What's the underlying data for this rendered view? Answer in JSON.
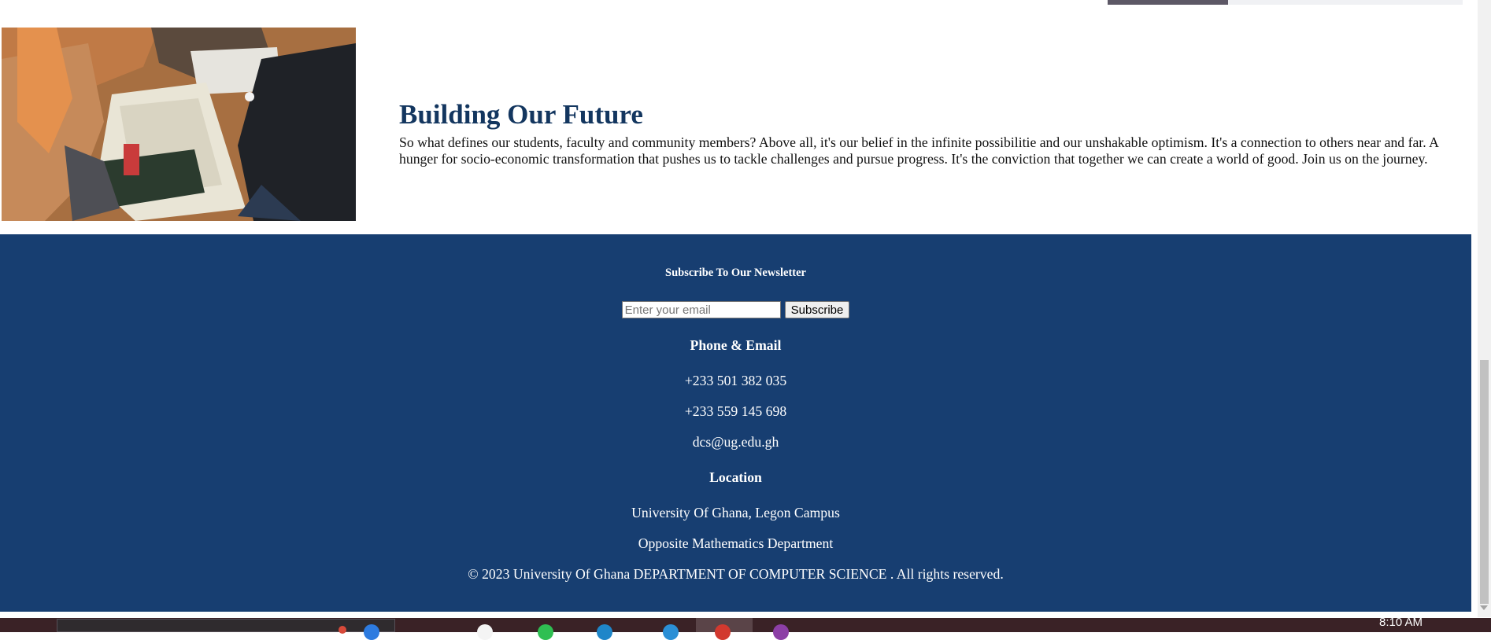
{
  "feature": {
    "title": "Building Our Future",
    "body": "So what defines our students, faculty and community members? Above all, it's our belief in the infinite possibilitie and our unshakable optimism. It's a connection to others near and far. A hunger for socio-economic transformation that pushes us to tackle challenges and pursue progress. It's the conviction that together we can create a world of good. Join us on the journey."
  },
  "footer": {
    "newsletter_title": "Subscribe To Our Newsletter",
    "email_placeholder": "Enter your email",
    "email_value": "",
    "subscribe_label": "Subscribe",
    "contact_heading": "Phone & Email",
    "phone_1": "+233 501 382 035",
    "phone_2": "+233 559 145 698",
    "email": "dcs@ug.edu.gh",
    "location_heading": "Location",
    "location_1": "University Of Ghana, Legon Campus",
    "location_2": "Opposite Mathematics Department",
    "copyright": "© 2023 University Of Ghana DEPARTMENT OF COMPUTER SCIENCE . All rights reserved."
  },
  "taskbar": {
    "clock": "8:10 AM"
  },
  "colors": {
    "footer_bg": "#173e71",
    "title": "#13365f"
  }
}
